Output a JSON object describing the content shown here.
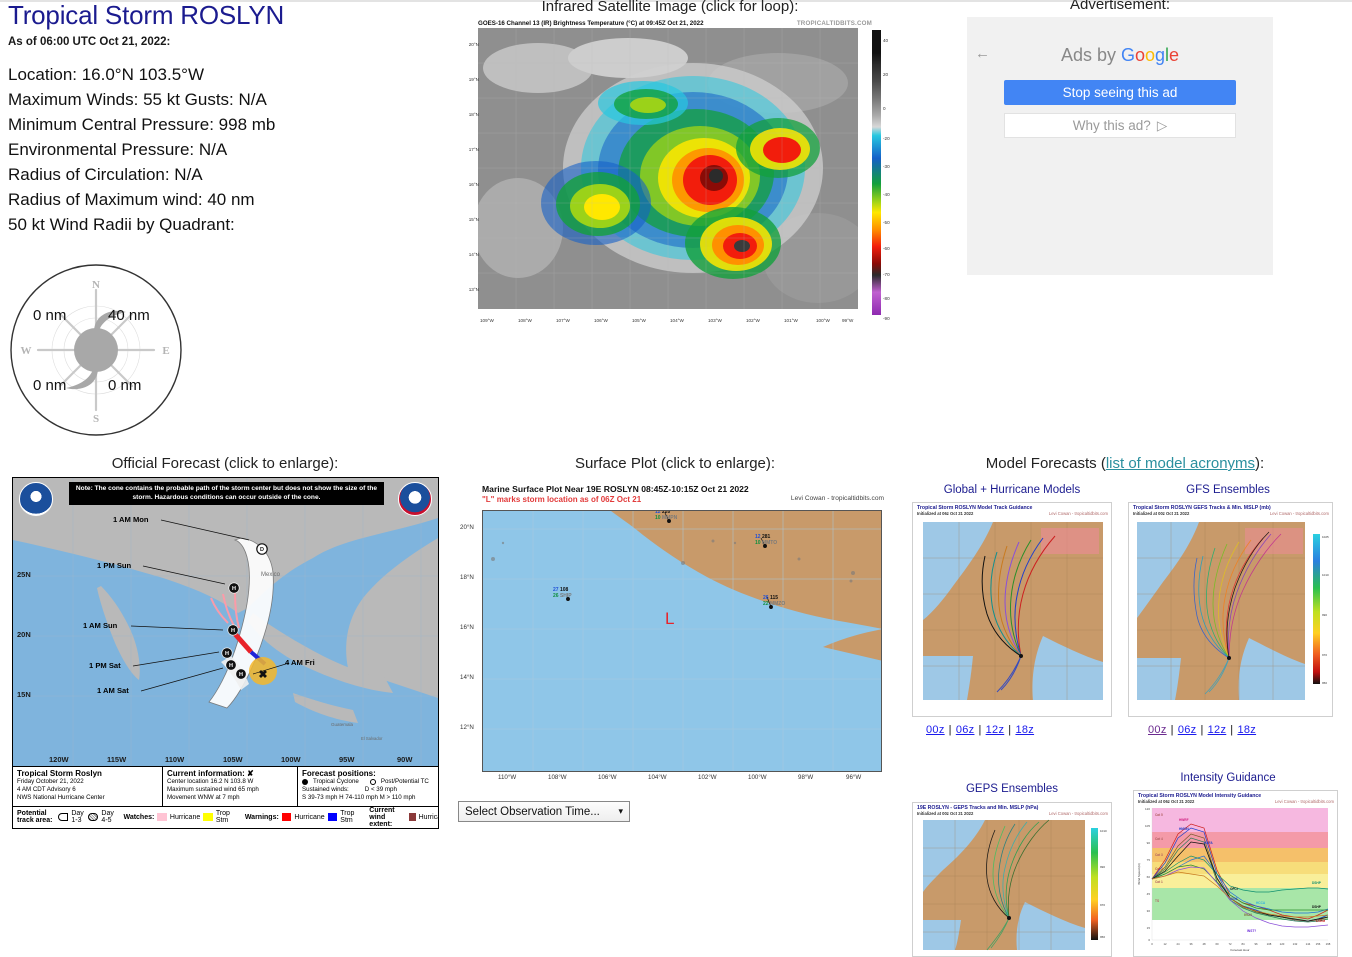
{
  "header": {
    "storm_title": "Tropical Storm ROSLYN",
    "as_of": "As of 06:00 UTC Oct 21, 2022:",
    "lines": [
      "Location: 16.0°N 103.5°W",
      "Maximum Winds: 55 kt  Gusts: N/A",
      "Minimum Central Pressure: 998 mb",
      "Environmental Pressure: N/A",
      "Radius of Circulation: N/A",
      "Radius of Maximum wind: 40 nm",
      "50 kt Wind Radii by Quadrant:"
    ]
  },
  "compass": {
    "north": "N",
    "south": "S",
    "east": "E",
    "west": "W",
    "nw": "0 nm",
    "ne": "40 nm",
    "sw": "0 nm",
    "se": "0 nm"
  },
  "satellite": {
    "caption": "Infrared Satellite Image (click for loop):",
    "title": "GOES-16 Channel 13 (IR) Brightness Temperature (°C) at 09:45Z Oct 21, 2022",
    "brand": "TROPICALTIDBITS.COM",
    "lat_ticks": [
      "20°N",
      "19°N",
      "18°N",
      "17°N",
      "16°N",
      "15°N",
      "14°N",
      "13°N"
    ],
    "lon_ticks": [
      "109°W",
      "108°W",
      "107°W",
      "106°W",
      "105°W",
      "104°W",
      "103°W",
      "102°W",
      "101°W",
      "100°W",
      "99°W"
    ],
    "colorbar_ticks": [
      "40",
      "20",
      "0",
      "-20",
      "-30",
      "-40",
      "-50",
      "-60",
      "-70",
      "-80",
      "-90"
    ]
  },
  "ad": {
    "caption": "Advertisement:",
    "back_icon": "back-arrow-icon",
    "ads_by_prefix": "Ads by ",
    "google": "Google",
    "stop_label": "Stop seeing this ad",
    "why_label": "Why this ad?",
    "why_icon": "play-triangle-icon"
  },
  "forecast": {
    "caption": "Official Forecast (click to enlarge):",
    "note": "Note: The cone contains the probable path of the storm center but does not show the size of the storm. Hazardous conditions can occur outside of the cone.",
    "lat_ticks": [
      "25N",
      "20N",
      "15N"
    ],
    "lon_ticks": [
      "120W",
      "115W",
      "110W",
      "105W",
      "100W",
      "95W",
      "90W"
    ],
    "track_labels": [
      "1 AM Mon",
      "1 PM Sun",
      "1 AM Sun",
      "1 PM Sat",
      "1 AM Sat",
      "4 AM Fri"
    ],
    "map_places": [
      "Mexico",
      "Guatemala",
      "El Salvador"
    ],
    "legend": {
      "storm_name": "Tropical Storm Roslyn",
      "date": "Friday October 21, 2022",
      "advisory": "4 AM CDT Advisory 6",
      "agency": "NWS National Hurricane Center",
      "current_info_title": "Current information: ✘",
      "current_center": "Center location 16.2 N 103.8 W",
      "current_wind": "Maximum sustained wind 65 mph",
      "current_move": "Movement WNW at 7 mph",
      "forecast_title": "Forecast positions:",
      "fc_cyclone": "Tropical Cyclone",
      "fc_post": "Post/Potential TC",
      "fc_sustained": "Sustained winds:",
      "fc_d": "D < 39 mph",
      "fc_scale": "S 39-73 mph  H 74-110 mph  M > 110 mph",
      "track_area_title": "Potential track area:",
      "day13": "Day 1-3",
      "day45": "Day 4-5",
      "watches_title": "Watches:",
      "warnings_title": "Warnings:",
      "extent_title": "Current wind extent:",
      "hurricane": "Hurricane",
      "tropstm": "Trop Stm"
    }
  },
  "surface": {
    "caption": "Surface Plot (click to enlarge):",
    "title": "Marine Surface Plot Near 19E ROSLYN 08:45Z-10:15Z Oct 21 2022",
    "subtitle": "\"L\" marks storm location as of 06Z Oct 21",
    "credit": "Levi Cowan - tropicaltidbits.com",
    "low_marker": "L",
    "lat_ticks": [
      "20°N",
      "18°N",
      "16°N",
      "14°N",
      "12°N"
    ],
    "lon_ticks": [
      "110°W",
      "108°W",
      "106°W",
      "104°W",
      "102°W",
      "100°W",
      "98°W",
      "96°W"
    ],
    "observations": [
      {
        "temp": "27",
        "dew": "26",
        "pressure": "108",
        "station": "SHIP"
      },
      {
        "temp": "12",
        "dew": "10",
        "pressure": "220",
        "station": "MMPN"
      },
      {
        "temp": "12",
        "dew": "10",
        "pressure": "281",
        "station": "MMTO"
      },
      {
        "temp": "26",
        "dew": "22",
        "pressure": "115",
        "station": "MMZO"
      }
    ],
    "select_label": "Select Observation Time...",
    "select_icon": "chevron-down-icon"
  },
  "models": {
    "caption_prefix": "Model Forecasts (",
    "caption_link": "list of model acronyms",
    "caption_suffix": "):",
    "panels": [
      {
        "heading": "Global + Hurricane Models",
        "title": "Tropical Storm ROSLYN Model Track Guidance",
        "init": "Initialized at 06z Oct 21 2022",
        "credit": "Levi Cowan - tropicaltidbits.com",
        "links": [
          "00z",
          "06z",
          "12z",
          "18z"
        ],
        "visited": []
      },
      {
        "heading": "GFS Ensembles",
        "title": "Tropical Storm ROSLYN GEFS Tracks & Min. MSLP (mb)",
        "init": "Initialized at 00z Oct 21 2022",
        "credit": "Levi Cowan - tropicaltidbits.com",
        "links": [
          "00z",
          "06z",
          "12z",
          "18z"
        ],
        "visited": [
          "00z"
        ]
      },
      {
        "heading": "GEPS Ensembles",
        "title": "19E ROSLYN - GEPS Tracks and Min. MSLP (hPa)",
        "init": "Initialized at 00z Oct 21 2022",
        "credit": "Levi Cowan - tropicaltidbits.com",
        "links": [],
        "visited": []
      },
      {
        "heading": "Intensity Guidance",
        "title": "Tropical Storm ROSLYN Model Intensity Guidance",
        "init": "Initialized at 06z Oct 21 2022",
        "credit": "Levi Cowan - tropicaltidbits.com",
        "links": [],
        "visited": []
      }
    ]
  },
  "chart_data": {
    "type": "line",
    "title": "Tropical Storm ROSLYN Model Intensity Guidance",
    "xlabel": "Forecast Hour",
    "ylabel": "Wind Speed (kt)",
    "xlim": [
      0,
      168
    ],
    "ylim": [
      0,
      125
    ],
    "x": [
      0,
      12,
      24,
      36,
      48,
      60,
      72,
      84,
      96,
      108,
      120,
      132,
      144,
      156,
      168
    ],
    "xticks": [
      0,
      12,
      24,
      36,
      48,
      60,
      72,
      84,
      96,
      108,
      120,
      132,
      144,
      156,
      168
    ],
    "yticks": [
      0,
      15,
      30,
      45,
      60,
      75,
      90,
      105,
      120
    ],
    "category_bands": [
      {
        "label": "Cat 5",
        "min": 137,
        "max": 160,
        "color": "#f6b8e0"
      },
      {
        "label": "Cat 4",
        "min": 113,
        "max": 137,
        "color": "#f49aa8"
      },
      {
        "label": "Cat 3",
        "min": 96,
        "max": 113,
        "color": "#f5c06a"
      },
      {
        "label": "Cat 2",
        "min": 83,
        "max": 96,
        "color": "#f7dd7a"
      },
      {
        "label": "Cat 1",
        "min": 64,
        "max": 83,
        "color": "#f9ef9a"
      },
      {
        "label": "TS",
        "min": 34,
        "max": 64,
        "color": "#a8e6a8"
      }
    ],
    "series": [
      {
        "name": "HWRF",
        "color": "#cc1f1f",
        "values": [
          55,
          72,
          95,
          104,
          100,
          62,
          40,
          33,
          30,
          26,
          22,
          20,
          19,
          22,
          26
        ]
      },
      {
        "name": "HMON",
        "color": "#1f3fcc",
        "values": [
          55,
          70,
          92,
          100,
          96,
          58,
          38,
          30,
          26,
          22,
          20,
          18,
          17,
          19,
          22
        ]
      },
      {
        "name": "HAFA",
        "color": "#7a5a2a",
        "values": [
          55,
          66,
          84,
          94,
          90,
          55,
          38,
          30,
          25,
          22,
          20,
          18,
          17,
          18,
          20
        ]
      },
      {
        "name": "HAFB",
        "color": "#2a7a5a",
        "values": [
          55,
          64,
          80,
          90,
          86,
          52,
          36,
          28,
          24,
          21,
          19,
          17,
          16,
          17,
          19
        ]
      },
      {
        "name": "AVNI",
        "color": "#1f6fd8",
        "values": [
          55,
          60,
          66,
          72,
          76,
          58,
          42,
          34,
          30,
          27,
          25,
          24,
          24,
          25,
          27
        ]
      },
      {
        "name": "DSHP",
        "color": "#0f8f6f",
        "values": [
          55,
          62,
          70,
          74,
          70,
          58,
          48,
          45,
          43,
          43,
          45,
          46,
          47,
          47,
          46
        ]
      },
      {
        "name": "LGEM",
        "color": "#2a8f2a",
        "values": [
          55,
          60,
          66,
          68,
          64,
          52,
          42,
          36,
          32,
          30,
          30,
          30,
          30,
          30,
          30
        ]
      },
      {
        "name": "OFCI",
        "color": "#111111",
        "values": [
          55,
          63,
          76,
          88,
          86,
          54,
          40,
          31,
          27,
          24,
          22,
          20,
          19,
          20,
          22
        ]
      },
      {
        "name": "CTCI",
        "color": "#8a4fd8",
        "values": [
          55,
          58,
          64,
          68,
          66,
          50,
          36,
          26,
          20,
          16,
          14,
          13,
          13,
          14,
          15
        ]
      },
      {
        "name": "ICON",
        "color": "#c87a1f",
        "values": [
          55,
          58,
          62,
          60,
          58,
          48,
          38,
          30,
          26,
          23,
          21,
          20,
          20,
          21,
          22
        ]
      }
    ],
    "annotations": [
      "HWRF",
      "HMON",
      "HAFA",
      "HAFB",
      "AVNI",
      "DSHP",
      "LGEM",
      "OFCI",
      "CTCI",
      "ICON",
      "HCCA",
      "IVCN",
      "INST?"
    ]
  }
}
